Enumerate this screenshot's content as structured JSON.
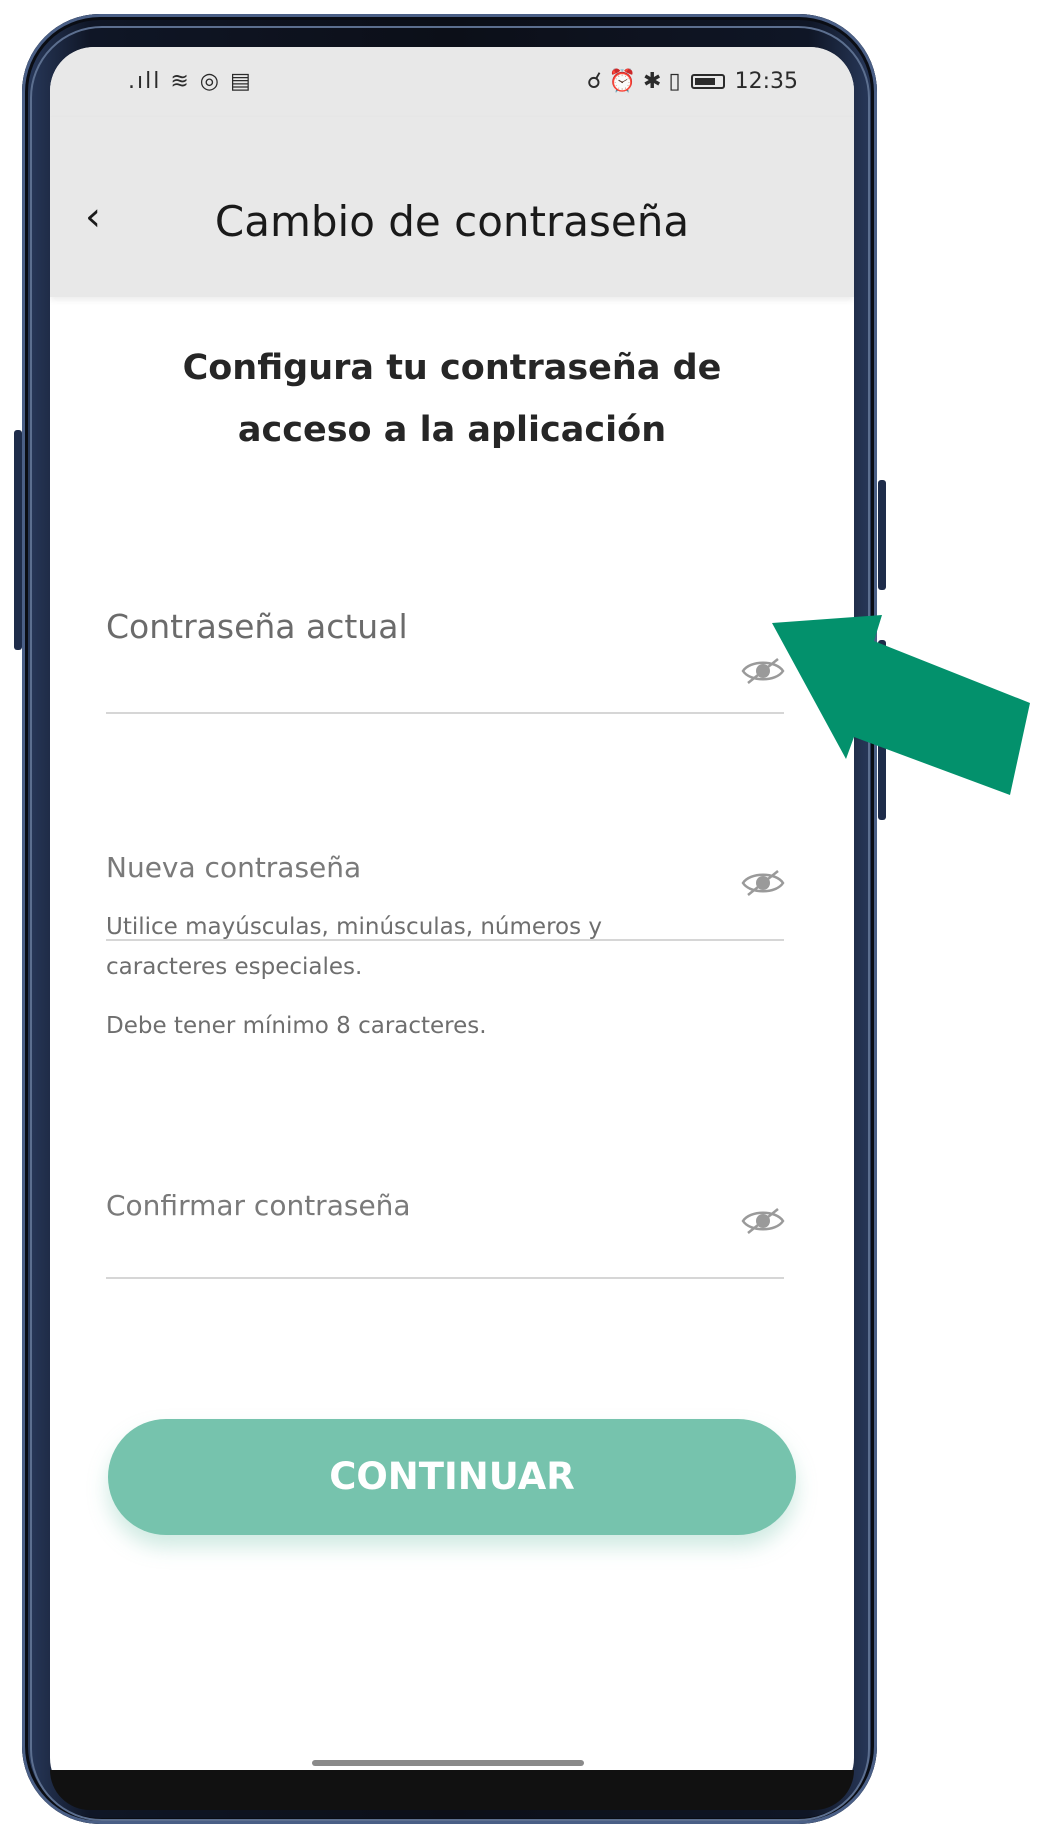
{
  "status_bar": {
    "left_icons": ".ıll ≋ ◎ ▤",
    "right_icons": "☌ ⏰ ✱ ▯",
    "time": "12:35"
  },
  "app_bar": {
    "back_icon": "‹",
    "title": "Cambio de contraseña"
  },
  "heading": {
    "line1": "Configura tu contraseña de",
    "line2": "acceso a la aplicación"
  },
  "fields": {
    "current": {
      "label": "Contraseña actual",
      "value": ""
    },
    "new": {
      "label": "Nueva contraseña",
      "value": ""
    },
    "confirm": {
      "label": "Confirmar contraseña",
      "value": ""
    }
  },
  "help": {
    "line1": "Utilice mayúsculas, minúsculas, números y",
    "line2": "caracteres especiales.",
    "line3": "Debe tener mínimo 8 caracteres."
  },
  "button": {
    "label": "CONTINUAR"
  },
  "colors": {
    "accent": "#76c3ad",
    "arrow": "#03916c",
    "app_bar": "#e8e8e8"
  }
}
